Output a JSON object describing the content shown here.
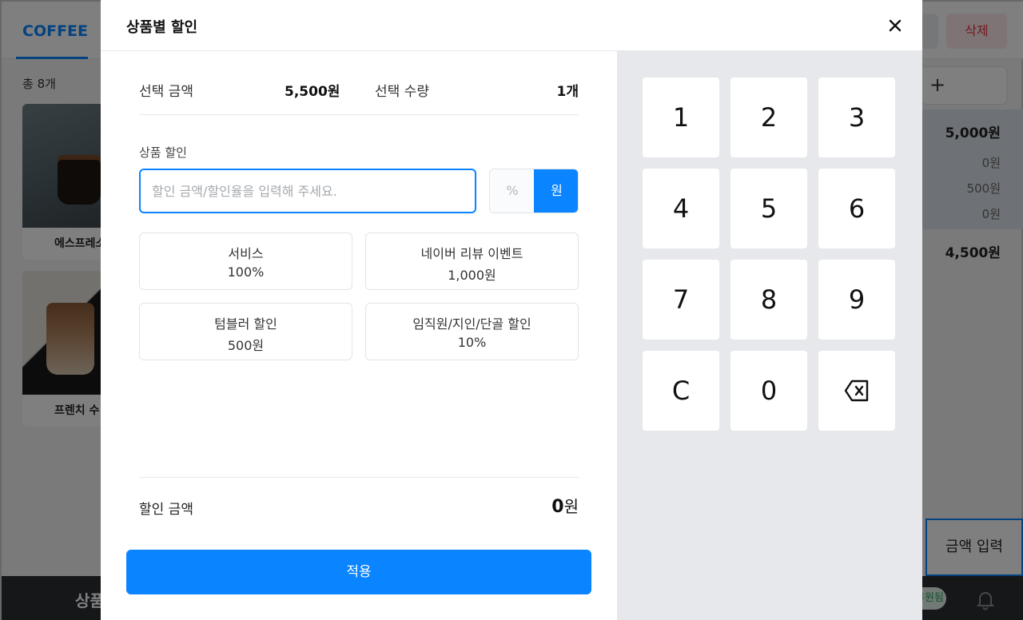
{
  "background": {
    "tab_label": "COFFEE",
    "count_label": "총 8개",
    "products": [
      {
        "label": "에스프레소"
      },
      {
        "label": "프렌치 수"
      }
    ],
    "delete_label": "삭제",
    "plus_label": "+",
    "summary": {
      "main": "5,000원",
      "lines": [
        "0원",
        "500원",
        "0원"
      ],
      "total": "4,500원"
    },
    "amount_input_label": "금액 입력",
    "bottom_label": "상품",
    "status_pill": "휴원됨"
  },
  "modal": {
    "title": "상품별 할인",
    "info": {
      "amount_label": "선택 금액",
      "amount_value": "5,500원",
      "qty_label": "선택 수량",
      "qty_value": "1개"
    },
    "discount": {
      "section_label": "상품 할인",
      "placeholder": "할인 금액/할인율을 입력해 주세요.",
      "value": "",
      "unit_percent": "%",
      "unit_won": "원",
      "selected_unit": "원"
    },
    "presets": [
      {
        "name": "서비스",
        "value": "100%"
      },
      {
        "name": "네이버 리뷰 이벤트",
        "value": "1,000원"
      },
      {
        "name": "텀블러 할인",
        "value": "500원"
      },
      {
        "name": "임직원/지인/단골 할인",
        "value": "10%"
      }
    ],
    "total": {
      "label": "할인 금액",
      "amount": "0",
      "unit": "원"
    },
    "apply_label": "적용",
    "keypad": [
      "1",
      "2",
      "3",
      "4",
      "5",
      "6",
      "7",
      "8",
      "9",
      "C",
      "0"
    ]
  },
  "colors": {
    "accent": "#0a84ff",
    "delete": "#e5323f",
    "keypad_bg": "#e6e8eb"
  },
  "icons": {
    "close": "close-icon",
    "backspace": "backspace-icon",
    "bell": "bell-icon"
  }
}
